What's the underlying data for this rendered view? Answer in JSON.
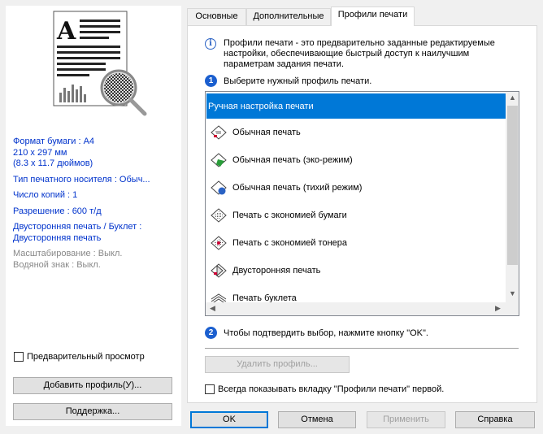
{
  "tabs": [
    {
      "label": "Основные"
    },
    {
      "label": "Дополнительные"
    },
    {
      "label": "Профили печати"
    }
  ],
  "summary": {
    "paper_size": "Формат бумаги : A4",
    "paper_dims_mm": "210 x 297 мм",
    "paper_dims_in": "(8.3 x 11.7 дюймов)",
    "media_type": "Тип печатного носителя : Обыч...",
    "copies": "Число копий : 1",
    "resolution": "Разрешение : 600 т/д",
    "duplex_label": "Двусторонняя печать / Буклет :",
    "duplex_value": "Двусторонняя печать",
    "scaling": "Масштабирование : Выкл.",
    "watermark": "Водяной знак : Выкл."
  },
  "left": {
    "preview_checkbox": "Предварительный просмотр",
    "add_profile_button": "Добавить профиль(У)...",
    "support_button": "Поддержка..."
  },
  "profiles": {
    "description": "Профили печати - это предварительно заданные редактируемые настройки, обеспечивающие быстрый доступ к наилучшим параметрам задания печати.",
    "step1_number": "1",
    "step1_text": "Выберите нужный профиль печати.",
    "items": [
      {
        "label": "Ручная настройка печати",
        "selected": true
      },
      {
        "label": "Обычная печать",
        "icon": "profile-normal-icon"
      },
      {
        "label": "Обычная печать (эко-режим)",
        "icon": "profile-eco-icon"
      },
      {
        "label": "Обычная печать (тихий режим)",
        "icon": "profile-quiet-icon"
      },
      {
        "label": "Печать с экономией бумаги",
        "icon": "profile-save-paper-icon"
      },
      {
        "label": "Печать с экономией тонера",
        "icon": "profile-save-toner-icon"
      },
      {
        "label": "Двусторонняя печать",
        "icon": "profile-duplex-icon"
      },
      {
        "label": "Печать буклета",
        "icon": "profile-booklet-icon"
      }
    ],
    "step2_number": "2",
    "step2_text": "Чтобы подтвердить выбор, нажмите кнопку \"OK\".",
    "delete_button": "Удалить профиль...",
    "always_show_checkbox": "Всегда показывать вкладку \"Профили печати\" первой."
  },
  "footer": {
    "ok": "OK",
    "cancel": "Отмена",
    "apply": "Применить",
    "help": "Справка"
  },
  "colors": {
    "selection": "#0078d7",
    "info_text": "#0033cc",
    "step_badge": "#1b5fcf"
  }
}
